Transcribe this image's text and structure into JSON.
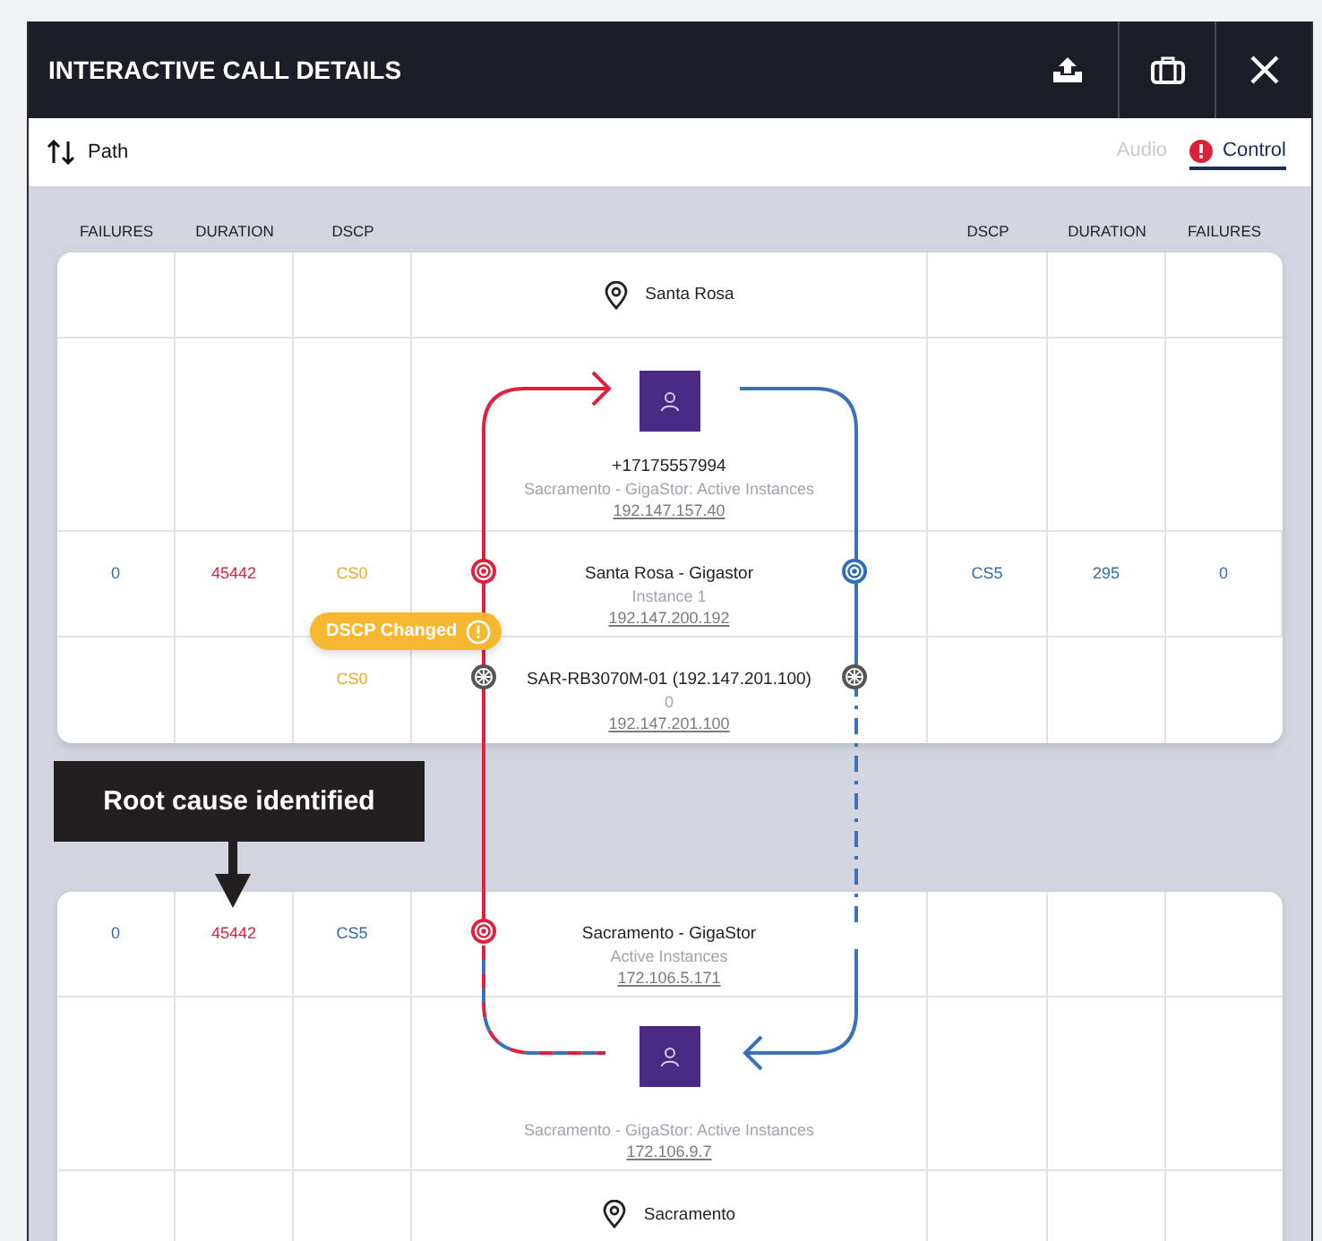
{
  "window": {
    "title": "INTERACTIVE CALL DETAILS"
  },
  "toolbar": {
    "sort_label": "Path",
    "tabs": [
      {
        "label": "Audio",
        "selected": false,
        "alert": false
      },
      {
        "label": "Control",
        "selected": true,
        "alert": true
      }
    ]
  },
  "columns_left": [
    "FAILURES",
    "DURATION",
    "DSCP"
  ],
  "columns_right": [
    "DSCP",
    "DURATION",
    "FAILURES"
  ],
  "segments": [
    {
      "rows": [
        {
          "kind": "location",
          "name": "Santa Rosa"
        },
        {
          "kind": "endpoint",
          "number": "+17175557994",
          "subtitle": "Sacramento - GigaStor: Active Instances",
          "address": "192.147.157.40"
        },
        {
          "kind": "hop",
          "left": {
            "failures": {
              "text": "0",
              "color": "#2f6db5"
            },
            "duration": {
              "text": "45442",
              "color": "#e0203c"
            },
            "dscp": {
              "text": "CS0",
              "color": "#f5a623"
            }
          },
          "right": {
            "dscp": {
              "text": "CS5",
              "color": "#2f6db5"
            },
            "duration": {
              "text": "295",
              "color": "#2f6db5"
            },
            "failures": {
              "text": "0",
              "color": "#2f6db5"
            }
          },
          "title": "Santa Rosa - Gigastor",
          "subtitle": "Instance 1",
          "address": "192.147.200.192",
          "markers": {
            "left": {
              "kind": "target",
              "color": "#e0203c"
            },
            "right": {
              "kind": "target",
              "color": "#2f6db5"
            }
          },
          "badge": {
            "label": "DSCP Changed"
          }
        },
        {
          "kind": "hop",
          "left": {
            "dscp": {
              "text": "CS0",
              "color": "#f5a623"
            }
          },
          "right": {},
          "title": "SAR-RB3070M-01 (192.147.201.100)",
          "subtitle": "0",
          "address": "192.147.201.100",
          "markers": {
            "left": {
              "kind": "hub",
              "color": "#555555"
            },
            "right": {
              "kind": "hub",
              "color": "#555555"
            }
          }
        }
      ]
    },
    {
      "rows": [
        {
          "kind": "hop",
          "left": {
            "failures": {
              "text": "0",
              "color": "#2f6db5"
            },
            "duration": {
              "text": "45442",
              "color": "#e0203c"
            },
            "dscp": {
              "text": "CS5",
              "color": "#2f6db5"
            }
          },
          "right": {},
          "title": "Sacramento - GigaStor",
          "subtitle": "Active Instances",
          "address": "172.106.5.171",
          "markers": {
            "left": {
              "kind": "target",
              "color": "#e0203c"
            }
          }
        },
        {
          "kind": "endpoint",
          "subtitle": "Sacramento - GigaStor: Active Instances",
          "address": "172.106.9.7"
        },
        {
          "kind": "location",
          "name": "Sacramento"
        }
      ]
    }
  ],
  "callout": {
    "text": "Root cause identified"
  }
}
